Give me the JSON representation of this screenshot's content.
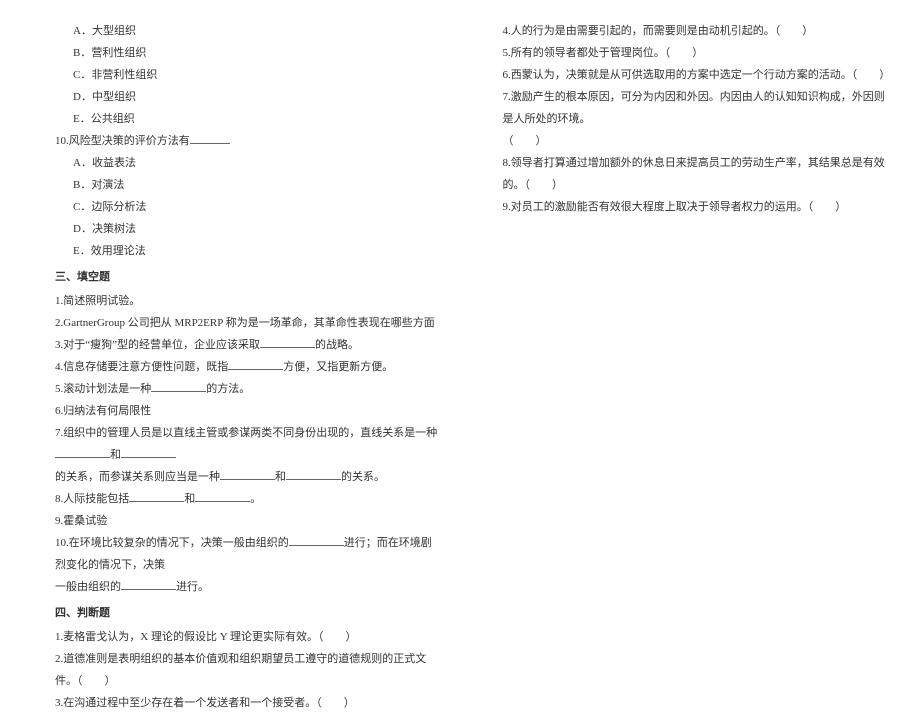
{
  "left": {
    "q9_options": {
      "a": "A．大型组织",
      "b": "B．营利性组织",
      "c": "C．非营利性组织",
      "d": "D．中型组织",
      "e": "E．公共组织"
    },
    "q10": {
      "stem_pre": "10.风险型决策的评价方法有",
      "a": "A．收益表法",
      "b": "B．对演法",
      "c": "C．边际分析法",
      "d": "D．决策树法",
      "e": "E．效用理论法"
    },
    "section3_header": "三、填空题",
    "fill": {
      "q1": "1.简述照明试验。",
      "q2": "2.GartnerGroup 公司把从 MRP2ERP 称为是一场革命，其革命性表现在哪些方面",
      "q3_pre": "3.对于“瘦狗”型的经营单位，企业应该采取",
      "q3_post": "的战略。",
      "q4_pre": "4.信息存储要注意方便性问题，既指",
      "q4_post": "方便，又指更新方便。",
      "q5_pre": "5.滚动计划法是一种",
      "q5_post": "的方法。",
      "q6": "6.归纳法有何局限性",
      "q7_pre": "7.组织中的管理人员是以直线主管或参谋两类不同身份出现的，直线关系是一种",
      "q7_mid": "和",
      "q7_line2_pre": "的关系，而参谋关系则应当是一种",
      "q7_line2_mid": "和",
      "q7_line2_post": "的关系。",
      "q8_pre": "8.人际技能包括",
      "q8_mid": "和",
      "q8_post": "。",
      "q9": "9.霍桑试验",
      "q10_pre": "10.在环境比较复杂的情况下，决策一般由组织的",
      "q10_mid": "进行；而在环境剧烈变化的情况下，决策",
      "q10_line2_pre": "一般由组织的",
      "q10_line2_post": "进行。"
    },
    "section4_header": "四、判断题",
    "judge": {
      "q1": "1.麦格雷戈认为，X 理论的假设比 Y 理论更实际有效。（　　）",
      "q2": "2.道德准则是表明组织的基本价值观和组织期望员工遵守的道德规则的正式文件。（　　）",
      "q3": "3.在沟通过程中至少存在着一个发送者和一个接受者。（　　）"
    }
  },
  "right": {
    "judge": {
      "q4": "4.人的行为是由需要引起的，而需要则是由动机引起的。（　　）",
      "q5": "5.所有的领导者都处于管理岗位。（　　）",
      "q6": "6.西蒙认为，决策就是从可供选取用的方案中选定一个行动方案的活动。（　　）",
      "q7_line1": "7.激励产生的根本原因，可分为内因和外因。内因由人的认知知识构成，外因则是人所处的环境。",
      "q7_line2": "（　　）",
      "q8": "8.领导者打算通过增加额外的休息日来提高员工的劳动生产率，其结果总是有效的。（　　）",
      "q9": "9.对员工的激励能否有效很大程度上取决于领导者权力的运用。（　　）"
    }
  }
}
